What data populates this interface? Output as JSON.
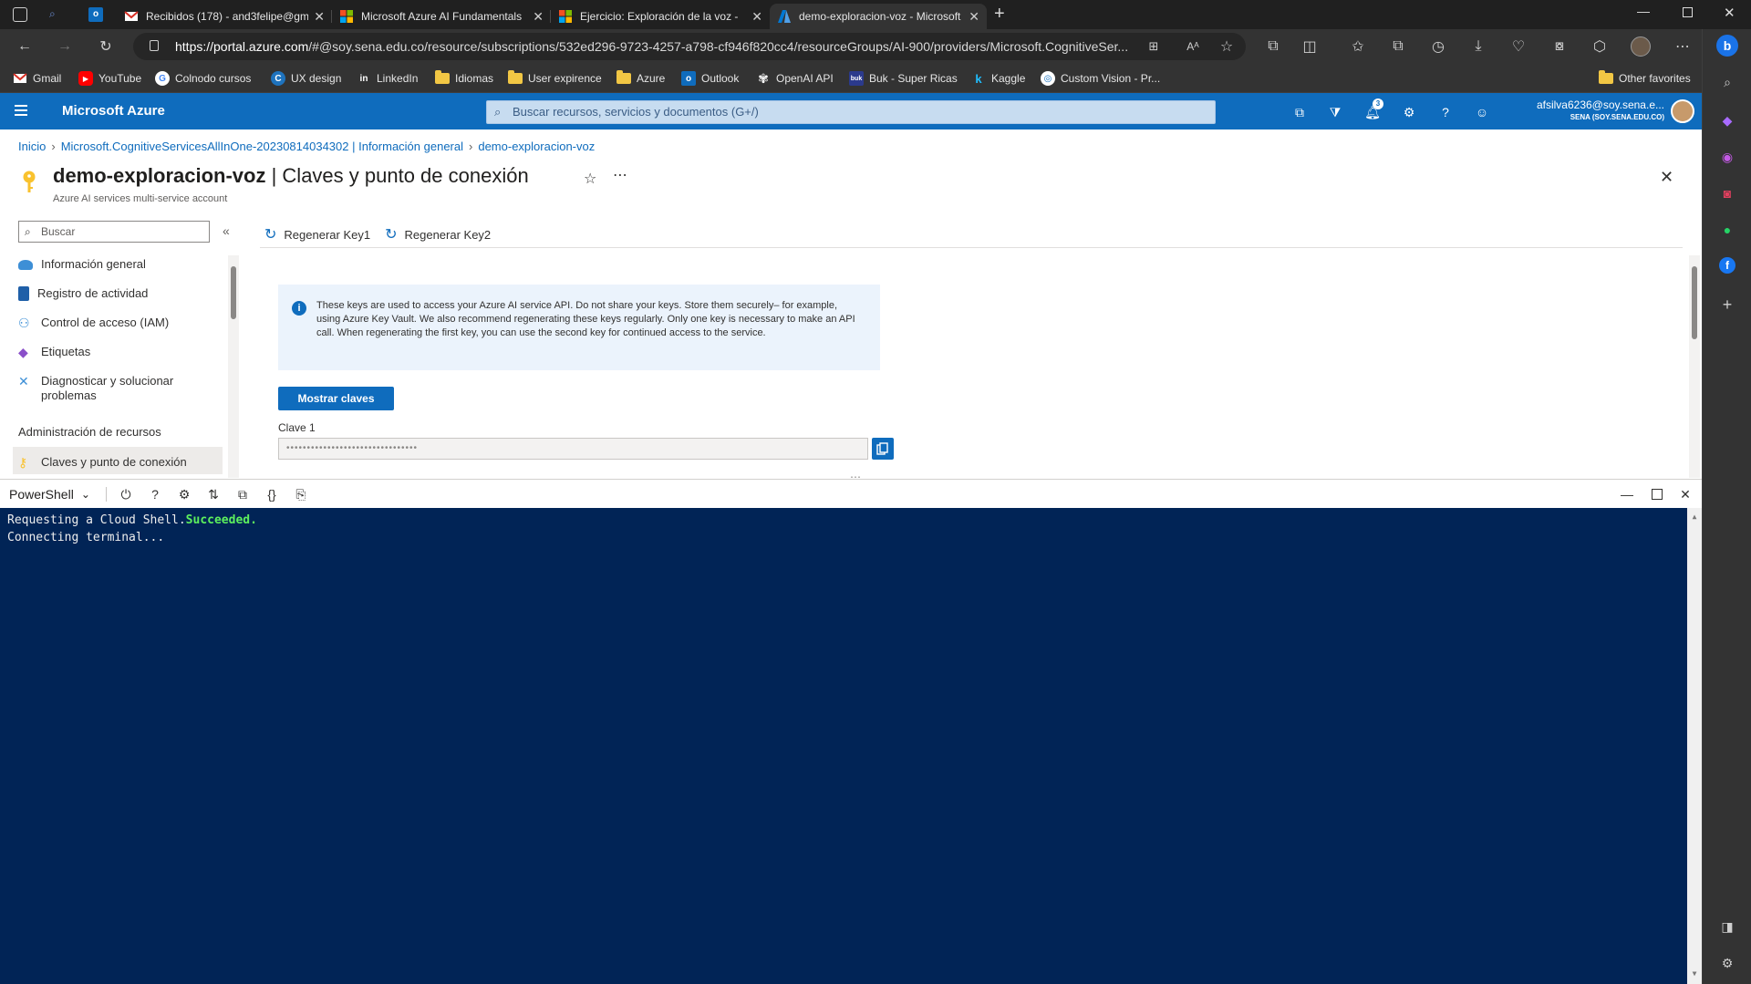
{
  "browser": {
    "tabs": [
      {
        "title": "Recibidos (178) - and3felipe@gm",
        "favicon": "gmail-icon"
      },
      {
        "title": "Microsoft Azure AI Fundamentals",
        "favicon": "microsoft-icon"
      },
      {
        "title": "Ejercicio: Exploración de la voz -",
        "favicon": "microsoft-icon"
      },
      {
        "title": "demo-exploracion-voz - Microsoft",
        "favicon": "azure-icon",
        "active": true
      }
    ],
    "url_host": "https://portal.azure.com",
    "url_path": "/#@soy.sena.edu.co/resource/subscriptions/532ed296-9723-4257-a798-cf946f820cc4/resourceGroups/AI-900/providers/Microsoft.CognitiveSer...",
    "favorites": [
      {
        "label": "Gmail",
        "icon": "gmail-icon"
      },
      {
        "label": "YouTube",
        "icon": "youtube-icon"
      },
      {
        "label": "Colnodo cursos",
        "icon": "google-icon"
      },
      {
        "label": "UX design",
        "icon": "c-icon"
      },
      {
        "label": "LinkedIn",
        "icon": "linkedin-icon"
      },
      {
        "label": "Idiomas",
        "icon": "folder-icon"
      },
      {
        "label": "User expirence",
        "icon": "folder-icon"
      },
      {
        "label": "Azure",
        "icon": "folder-icon"
      },
      {
        "label": "Outlook",
        "icon": "outlook-icon"
      },
      {
        "label": "OpenAI API",
        "icon": "openai-icon"
      },
      {
        "label": "Buk - Super Ricas",
        "icon": "buk-icon"
      },
      {
        "label": "Kaggle",
        "icon": "kaggle-icon"
      },
      {
        "label": "Custom Vision - Pr...",
        "icon": "custom-vision-icon"
      }
    ],
    "other_favorites": "Other favorites"
  },
  "azure": {
    "brand": "Microsoft Azure",
    "search_placeholder": "Buscar recursos, servicios y documentos (G+/)",
    "notification_count": "3",
    "account_email": "afsilva6236@soy.sena.e...",
    "account_org": "SENA (SOY.SENA.EDU.CO)"
  },
  "breadcrumb": [
    "Inicio",
    "Microsoft.CognitiveServicesAllInOne-20230814034302 | Información general",
    "demo-exploracion-voz"
  ],
  "page": {
    "resource_name": "demo-exploracion-voz",
    "title_suffix": " | Claves y punto de conexión",
    "subtitle": "Azure AI services multi-service account"
  },
  "sidebar": {
    "search_placeholder": "Buscar",
    "items": [
      {
        "label": "Información general",
        "icon": "overview-icon"
      },
      {
        "label": "Registro de actividad",
        "icon": "activity-log-icon"
      },
      {
        "label": "Control de acceso (IAM)",
        "icon": "iam-icon"
      },
      {
        "label": "Etiquetas",
        "icon": "tag-icon"
      },
      {
        "label": "Diagnosticar y solucionar problemas",
        "icon": "diagnose-icon"
      }
    ],
    "group_header": "Administración de recursos",
    "selected_item": {
      "label": "Claves y punto de conexión",
      "icon": "key-icon"
    }
  },
  "commands": {
    "regen1": "Regenerar Key1",
    "regen2": "Regenerar Key2"
  },
  "content": {
    "info_text": "These keys are used to access your Azure AI service API. Do not share your keys. Store them securely– for example, using Azure Key Vault. We also recommend regenerating these keys regularly. Only one key is necessary to make an API call. When regenerating the first key, you can use the second key for continued access to the service.",
    "show_keys_button": "Mostrar claves",
    "key1_label": "Clave 1",
    "key1_value": "••••••••••••••••••••••••••••••••"
  },
  "shell": {
    "type": "PowerShell",
    "line1_prefix": "Requesting a Cloud Shell.",
    "line1_status": "Succeeded.",
    "line2": "Connecting terminal..."
  },
  "colors": {
    "azure_blue": "#0f6cbd",
    "terminal_bg": "#012456",
    "success_green": "#5df05d"
  }
}
